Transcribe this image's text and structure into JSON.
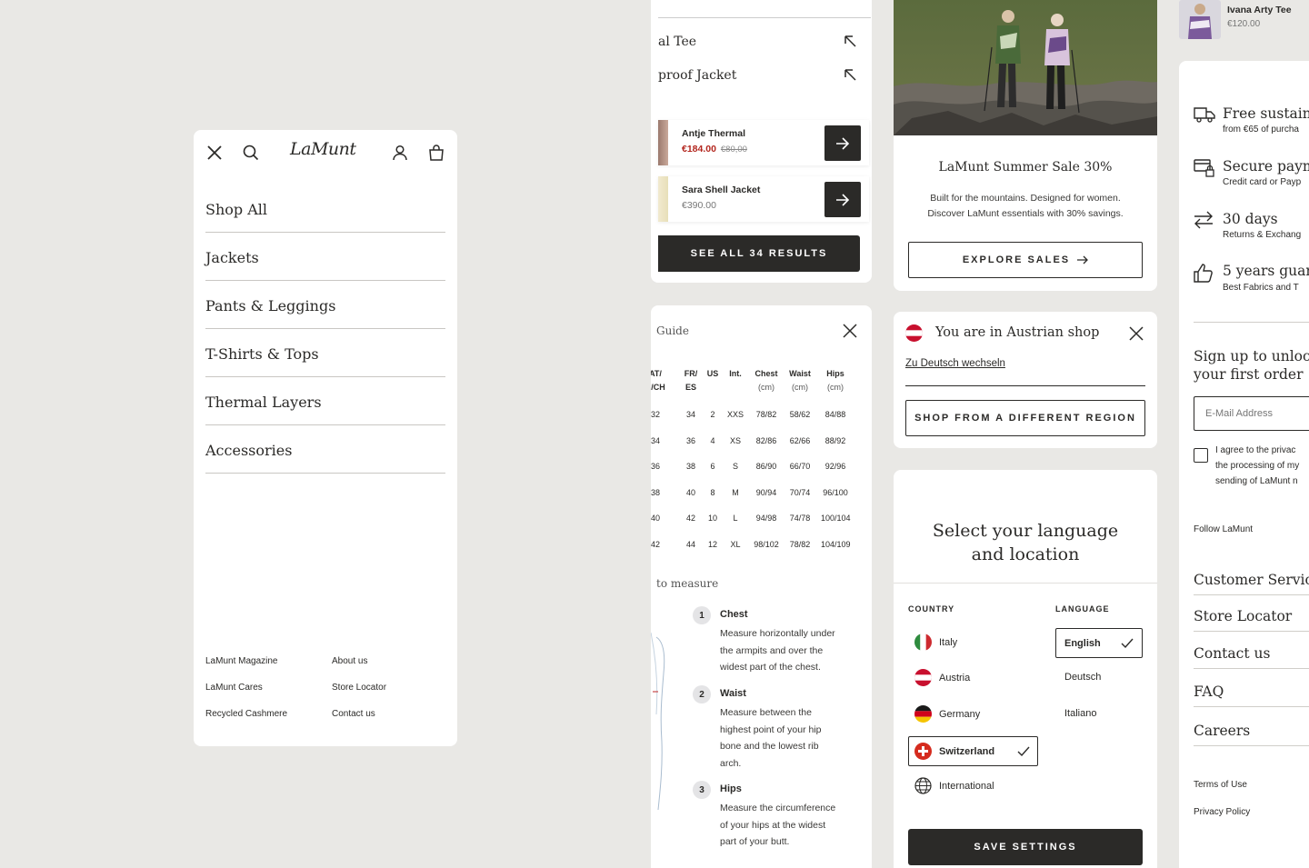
{
  "menu": {
    "logo": "LaMunt",
    "items": [
      "Shop All",
      "Jackets",
      "Pants & Leggings",
      "T-Shirts & Tops",
      "Thermal Layers",
      "Accessories"
    ],
    "footer_left": [
      "LaMunt Magazine",
      "LaMunt Cares",
      "Recycled Cashmere"
    ],
    "footer_right": [
      "About us",
      "Store Locator",
      "Contact us"
    ]
  },
  "search": {
    "suggestions": [
      "al Tee",
      "proof Jacket"
    ],
    "products": [
      {
        "name": "Antje Thermal",
        "price": "€184.00",
        "old_price": "€80,00"
      },
      {
        "name": "Sara Shell Jacket",
        "price": "€390.00"
      }
    ],
    "see_all": "SEE ALL 34 RESULTS"
  },
  "size_guide": {
    "title": "Guide",
    "headers": [
      [
        "AT/",
        "E/CH"
      ],
      [
        "FR/",
        "ES"
      ],
      [
        "US",
        ""
      ],
      [
        "Int.",
        ""
      ],
      [
        "Chest",
        "(cm)"
      ],
      [
        "Waist",
        "(cm)"
      ],
      [
        "Hips",
        "(cm)"
      ]
    ],
    "rows": [
      [
        "32",
        "34",
        "2",
        "XXS",
        "78/82",
        "58/62",
        "84/88"
      ],
      [
        "34",
        "36",
        "4",
        "XS",
        "82/86",
        "62/66",
        "88/92"
      ],
      [
        "36",
        "38",
        "6",
        "S",
        "86/90",
        "66/70",
        "92/96"
      ],
      [
        "38",
        "40",
        "8",
        "M",
        "90/94",
        "70/74",
        "96/100"
      ],
      [
        "40",
        "42",
        "10",
        "L",
        "94/98",
        "74/78",
        "100/104"
      ],
      [
        "42",
        "44",
        "12",
        "XL",
        "98/102",
        "78/82",
        "104/109"
      ]
    ],
    "measure_title": "to measure",
    "steps": [
      {
        "n": "1",
        "title": "Chest",
        "lines": [
          "Measure horizontally under",
          "the armpits and over the",
          "widest part of the chest."
        ]
      },
      {
        "n": "2",
        "title": "Waist",
        "lines": [
          "Measure between the",
          "highest point of your hip",
          "bone and the lowest rib",
          "arch."
        ]
      },
      {
        "n": "3",
        "title": "Hips",
        "lines": [
          "Measure the circumference",
          "of your hips at the widest",
          "part of your butt."
        ]
      }
    ]
  },
  "promo": {
    "title": "LaMunt Summer Sale 30%",
    "text_line1": "Built for the mountains. Designed for women.",
    "text_line2": "Discover LaMunt essentials with 30% savings.",
    "button": "EXPLORE SALES"
  },
  "region": {
    "title": "You are in Austrian shop",
    "link": "Zu Deutsch wechseln",
    "button": "SHOP FROM A DIFFERENT REGION"
  },
  "locale": {
    "title_line1": "Select your language",
    "title_line2": "and location",
    "country_label": "COUNTRY",
    "language_label": "LANGUAGE",
    "countries": [
      "Italy",
      "Austria",
      "Germany",
      "Switzerland",
      "International"
    ],
    "selected_country": "Switzerland",
    "languages": [
      "English",
      "Deutsch",
      "Italiano"
    ],
    "selected_language": "English",
    "save": "SAVE SETTINGS"
  },
  "mini_product": {
    "name": "Ivana Arty Tee",
    "price": "€120.00"
  },
  "footer": {
    "usps": [
      {
        "title": "Free sustaina",
        "sub": "from €65 of purcha",
        "icon": "truck-icon"
      },
      {
        "title": "Secure paym",
        "sub": "Credit card or Payp",
        "icon": "card-lock-icon"
      },
      {
        "title": "30 days",
        "sub": "Returns & Exchang",
        "icon": "swap-arrows-icon"
      },
      {
        "title": "5 years guara",
        "sub": "Best Fabrics and T",
        "icon": "thumbs-up-icon"
      }
    ],
    "signup_line1": "Sign up to unlock",
    "signup_line2": "your first order",
    "email_placeholder": "E-Mail Address",
    "consent_lines": [
      "I agree to the privac",
      "the processing of my",
      "sending of LaMunt n"
    ],
    "follow": "Follow LaMunt",
    "links": [
      "Customer Servic",
      "Store Locator",
      "Contact us",
      "FAQ",
      "Careers"
    ],
    "legal": [
      "Terms of Use",
      "Privacy Policy"
    ]
  },
  "colors": {
    "sale_red": "#b3261e",
    "dark": "#2b2a28",
    "background": "#e9e8e5"
  }
}
